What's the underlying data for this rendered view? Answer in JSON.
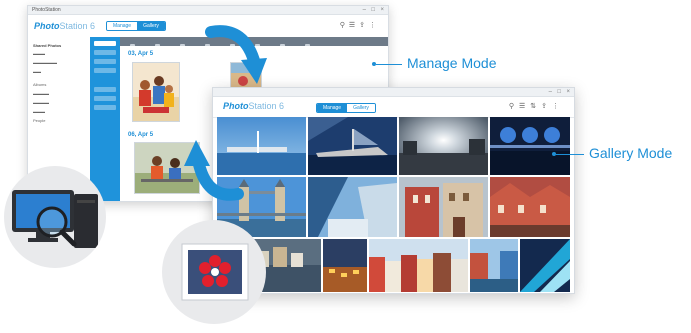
{
  "manage_window": {
    "title": "PhotoStation",
    "brand_bold": "Photo",
    "brand_light": "Station 6",
    "toggle": {
      "manage": "Manage",
      "gallery": "Gallery"
    },
    "sidebar_sections": [
      "Shared Photos",
      "Albums",
      "People"
    ],
    "date_1": "03, Apr 5",
    "date_2": "06, Apr 5"
  },
  "gallery_window": {
    "brand_bold": "Photo",
    "brand_light": "Station 6",
    "toggle": {
      "manage": "Manage",
      "gallery": "Gallery"
    }
  },
  "labels": {
    "manage_mode": "Manage Mode",
    "gallery_mode": "Gallery Mode"
  },
  "colors": {
    "accent": "#1e8fd6",
    "sidebar_blue": "#1f93db",
    "toolbar": "#6d7a88",
    "flower": "#e2202d",
    "flower_bg": "#3a4f7a"
  },
  "icons": {
    "arrow_down": "curved-arrow-icon",
    "arrow_up": "curved-arrow-icon",
    "computer": "computer-magnifier-icon",
    "photo": "flower-photo-icon"
  }
}
